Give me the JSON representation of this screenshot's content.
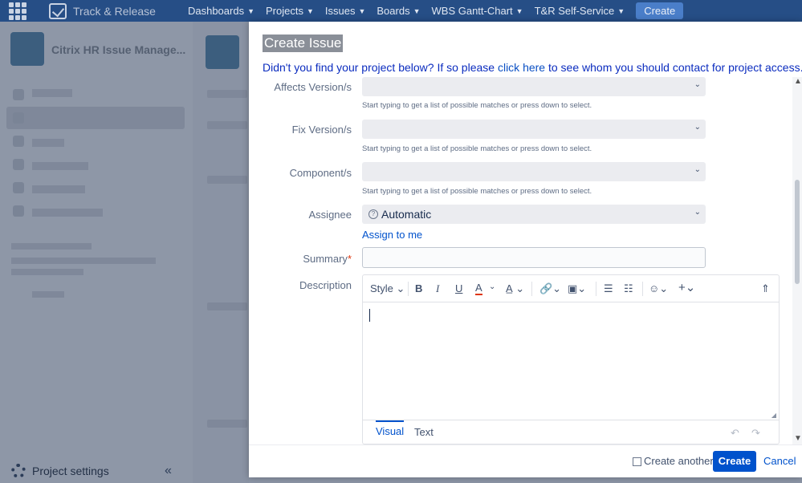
{
  "topnav": {
    "app_title": "Track & Release",
    "items": [
      {
        "label": "Dashboards"
      },
      {
        "label": "Projects"
      },
      {
        "label": "Issues"
      },
      {
        "label": "Boards"
      },
      {
        "label": "WBS Gantt-Chart"
      },
      {
        "label": "T&R Self-Service"
      }
    ],
    "create_label": "Create"
  },
  "sidebar": {
    "project_name": "Citrix HR Issue Manage...",
    "project_settings_label": "Project settings"
  },
  "modal": {
    "title": "Create Issue",
    "notice_prefix": "Didn't you find your project below? If so please ",
    "notice_link": "click here",
    "notice_suffix": " to see whom you should contact for project access.",
    "fields": {
      "affects_version": {
        "label": "Affects Version/s",
        "hint": "Start typing to get a list of possible matches or press down to select."
      },
      "fix_version": {
        "label": "Fix Version/s",
        "hint": "Start typing to get a list of possible matches or press down to select."
      },
      "component": {
        "label": "Component/s",
        "hint": "Start typing to get a list of possible matches or press down to select."
      },
      "assignee": {
        "label": "Assignee",
        "value": "Automatic",
        "assign_to_me": "Assign to me"
      },
      "summary": {
        "label": "Summary",
        "required_marker": "*",
        "value": ""
      },
      "description": {
        "label": "Description"
      }
    },
    "editor": {
      "style_label": "Style",
      "tabs": {
        "visual": "Visual",
        "text": "Text"
      }
    },
    "footer": {
      "create_another_label": "Create another",
      "create_label": "Create",
      "cancel_label": "Cancel"
    }
  }
}
